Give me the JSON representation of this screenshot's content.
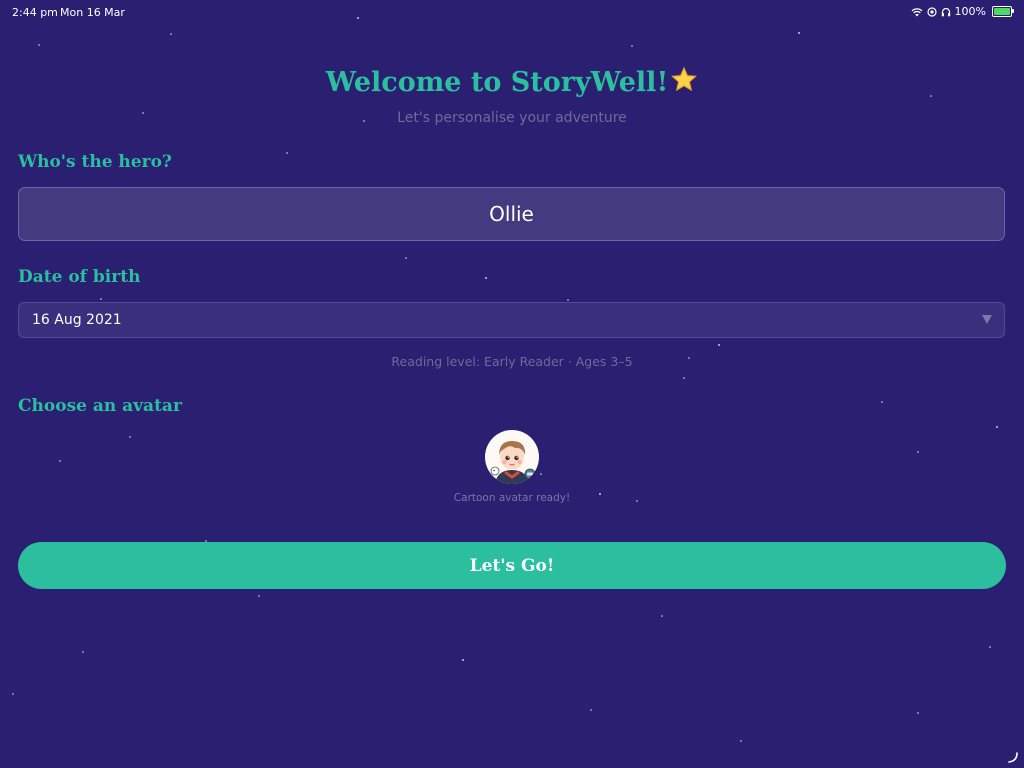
{
  "status_bar": {
    "time": "2:44 pm",
    "date": "Mon 16 Mar",
    "battery": "100%",
    "battery_level": 1.0,
    "icons": [
      "wifi-icon",
      "location-icon",
      "headphones-icon",
      "battery-icon"
    ]
  },
  "header": {
    "title": "Welcome to StoryWell!",
    "title_icon": "star-icon",
    "subtitle": "Let's personalise your adventure"
  },
  "hero": {
    "label": "Who's the hero?",
    "value": "Ollie"
  },
  "dob": {
    "label": "Date of birth",
    "value": "16 Aug 2021",
    "icon": "chevron-down-icon"
  },
  "reading_level": "Reading level: Early Reader · Ages 3–5",
  "avatar": {
    "label": "Choose an avatar",
    "caption": "Cartoon avatar ready!",
    "image": "cartoon-child-avatar"
  },
  "cta": {
    "label": "Let's Go!"
  },
  "colors": {
    "background": "#2a1f70",
    "accent": "#2bbfa0",
    "muted_text": "#6e6a99",
    "input_bg": "#433a80"
  }
}
